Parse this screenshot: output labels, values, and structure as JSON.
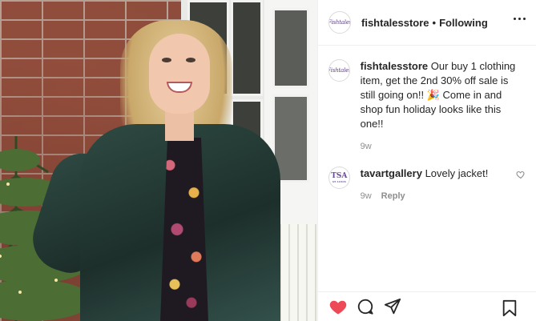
{
  "post": {
    "username": "fishtalesstore",
    "separator": "•",
    "follow_status": "Following",
    "avatar_text": "Fishtales",
    "accent_color": "#ed4956",
    "caption": {
      "username": "fishtalesstore",
      "text": "Our buy 1 clothing item, get the 2nd 30% off sale is still going on!! 🎉 Come in and shop fun holiday looks like this one!!",
      "time": "9w"
    }
  },
  "comments": [
    {
      "username": "tavartgallery",
      "text": "Lovely jacket!",
      "time": "9w",
      "reply_label": "Reply",
      "avatar_text_top": "TSA",
      "avatar_text_bottom": "ST. LOUIS"
    }
  ],
  "actions": {
    "liked": true,
    "icons": [
      "heart-filled-icon",
      "comment-icon",
      "share-icon",
      "bookmark-icon"
    ]
  }
}
